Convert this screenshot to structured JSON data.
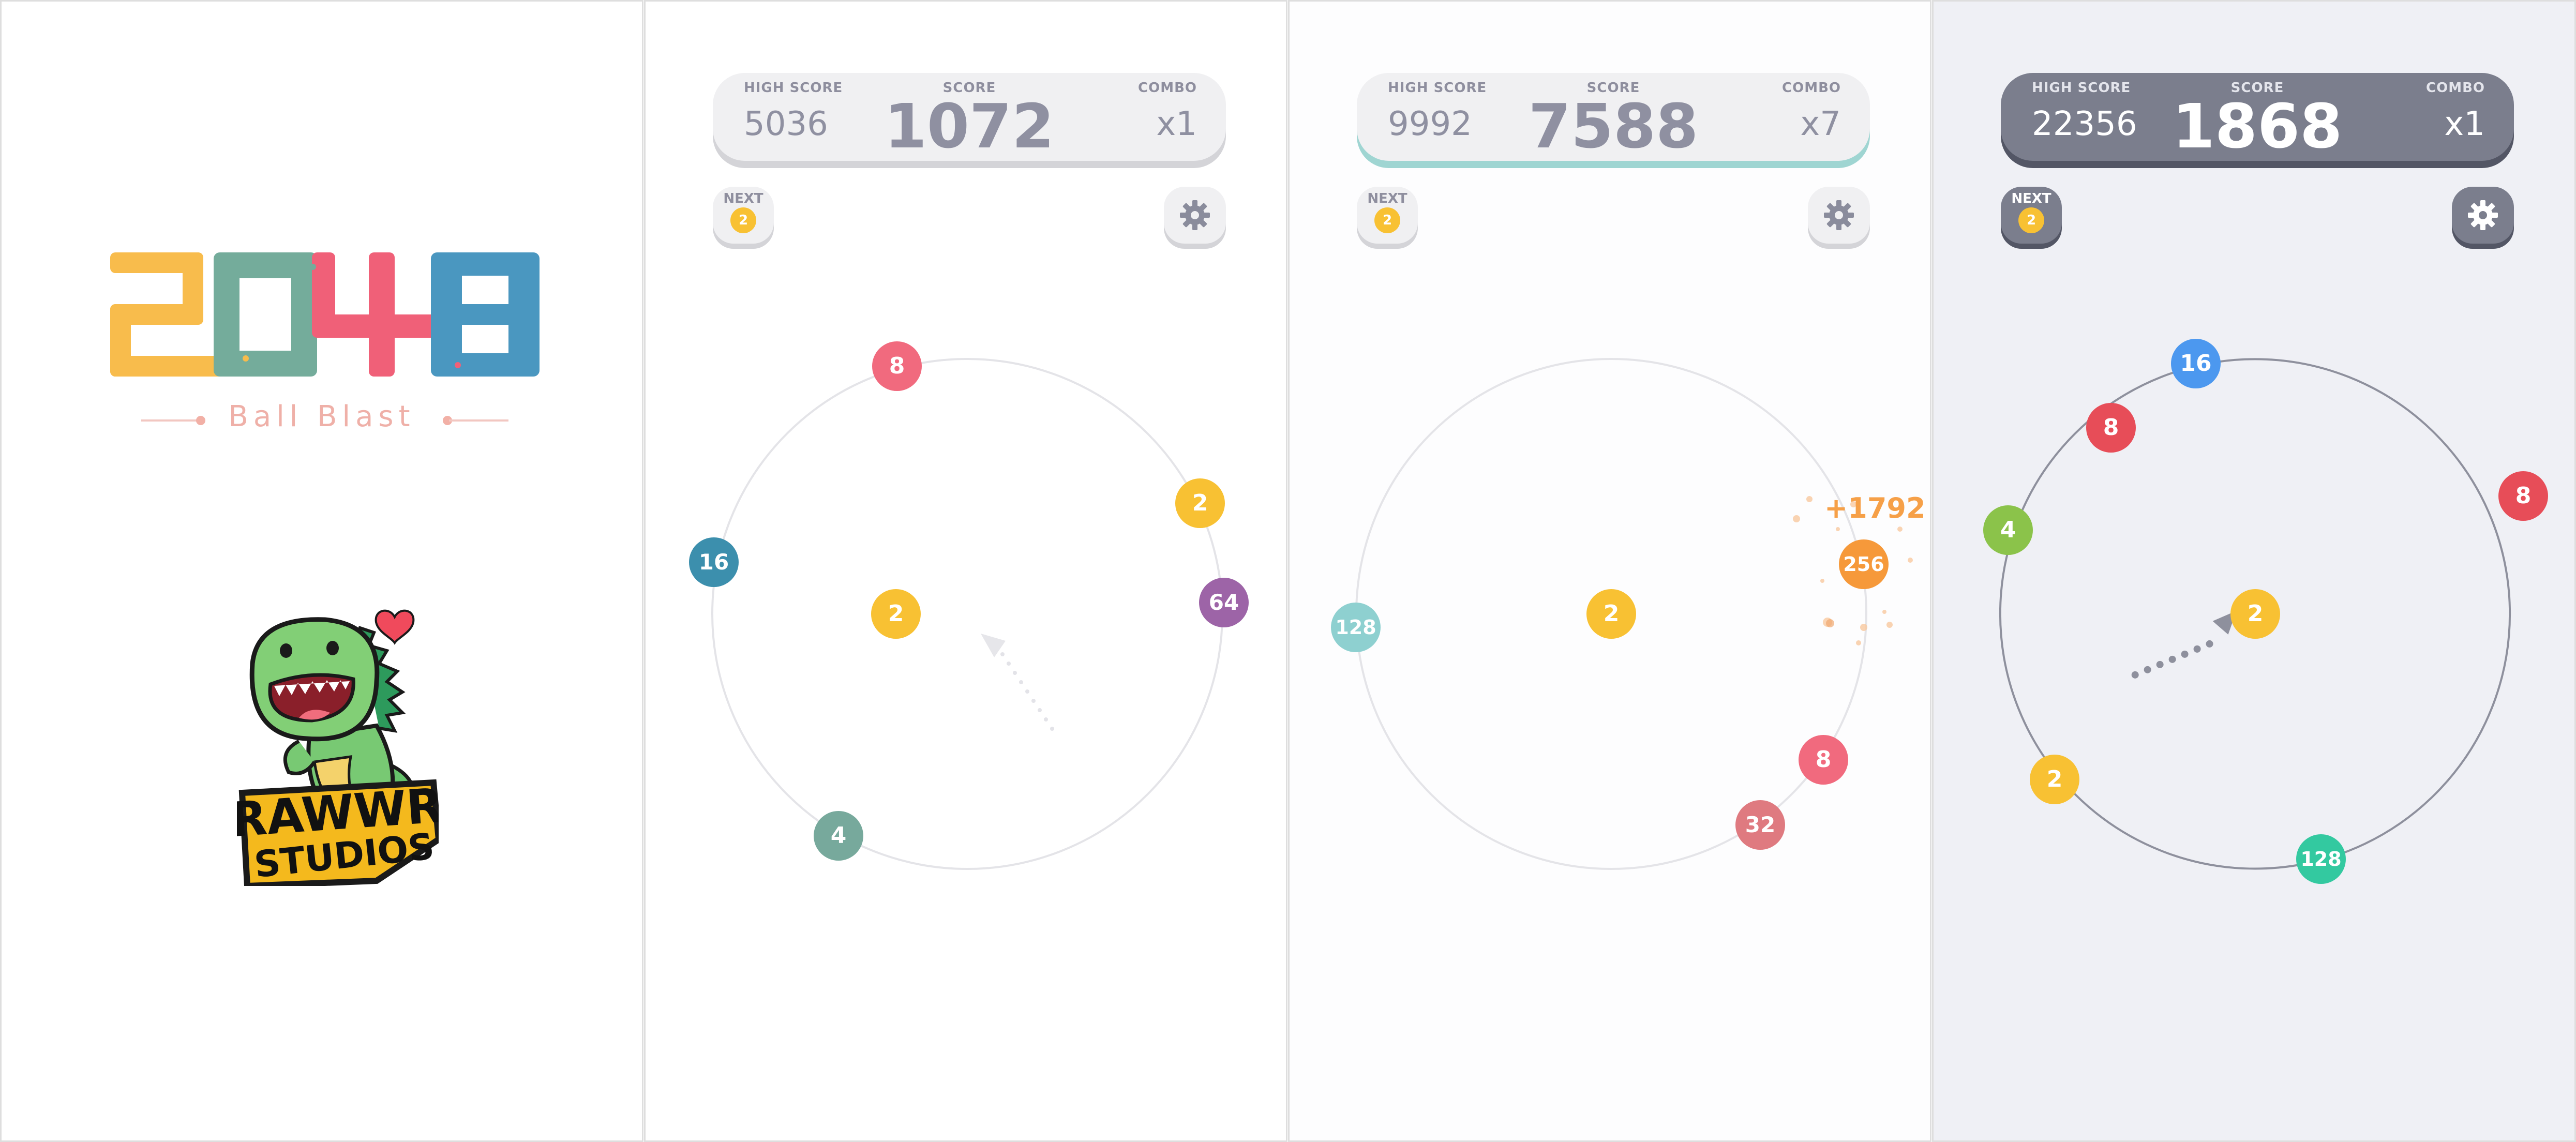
{
  "splash": {
    "logo_text": "2048",
    "subtitle": "Ball Blast",
    "studio_line1": "RAWWR",
    "studio_line2": "STUDIOS"
  },
  "hud_labels": {
    "high": "HIGH SCORE",
    "score": "SCORE",
    "combo": "COMBO",
    "next": "NEXT"
  },
  "screens": [
    {
      "high_score": "5036",
      "score": "1072",
      "combo": "x1",
      "next": "2",
      "center_ball": "2",
      "balls": [
        {
          "value": "8",
          "color": "#f16a7e"
        },
        {
          "value": "2",
          "color": "#f8c133"
        },
        {
          "value": "64",
          "color": "#9d64a7"
        },
        {
          "value": "4",
          "color": "#77a99c"
        },
        {
          "value": "16",
          "color": "#3c8fad"
        }
      ]
    },
    {
      "high_score": "9992",
      "score": "7588",
      "combo": "x7",
      "next": "2",
      "center_ball": "2",
      "bonus": "+1792",
      "balls": [
        {
          "value": "256",
          "color": "#f6993a"
        },
        {
          "value": "8",
          "color": "#f16a7e"
        },
        {
          "value": "32",
          "color": "#df7a80"
        },
        {
          "value": "128",
          "color": "#8ed0d0"
        }
      ]
    },
    {
      "high_score": "22356",
      "score": "1868",
      "combo": "x1",
      "next": "2",
      "center_ball": "2",
      "balls": [
        {
          "value": "16",
          "color": "#4c98ef"
        },
        {
          "value": "8",
          "color": "#e74d58"
        },
        {
          "value": "8",
          "color": "#e74d58"
        },
        {
          "value": "4",
          "color": "#8bc34a"
        },
        {
          "value": "2",
          "color": "#f8c133"
        },
        {
          "value": "128",
          "color": "#33c9a0"
        }
      ]
    }
  ],
  "colors": {
    "ball_yellow": "#f8c133",
    "ring_light": "#e4e4e8",
    "ring_dark": "#8e909d"
  }
}
